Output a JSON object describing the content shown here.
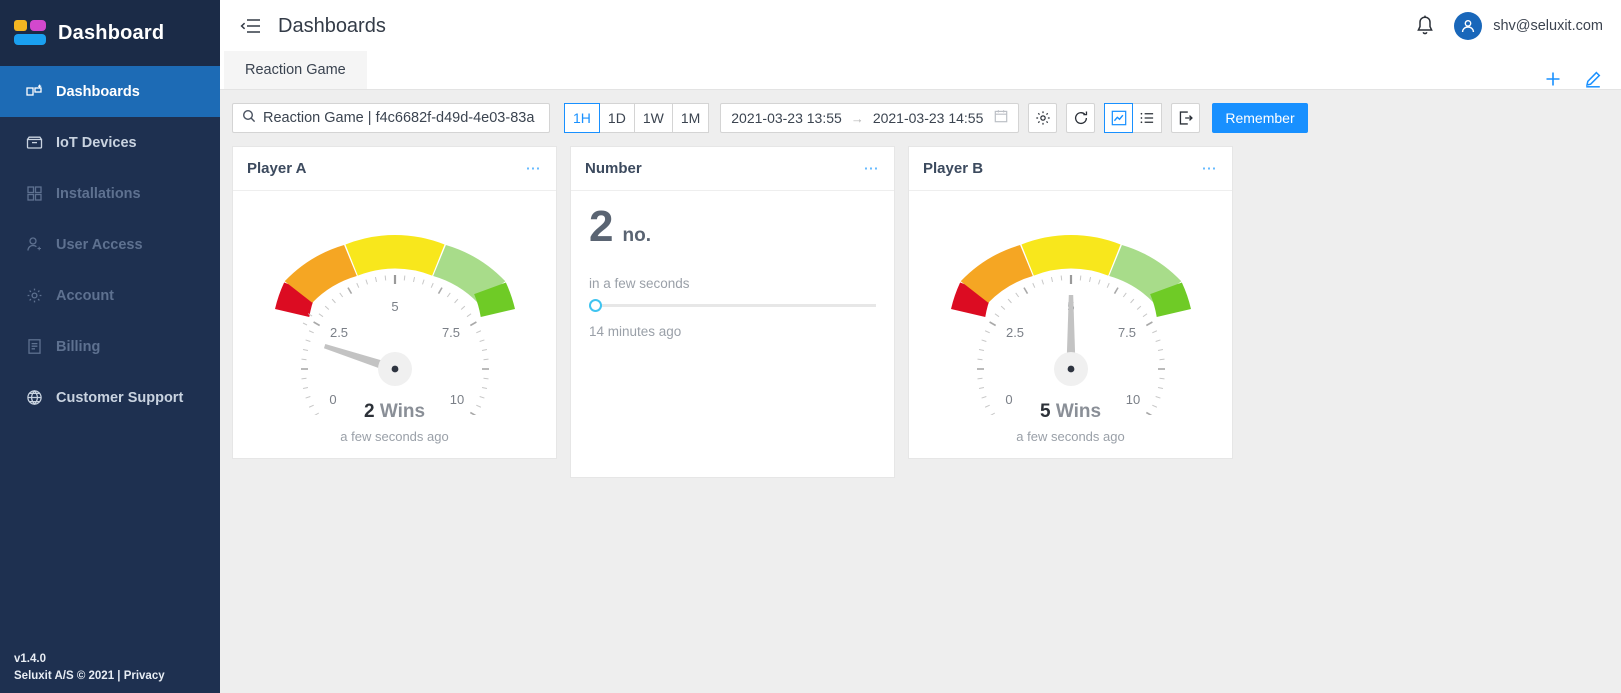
{
  "brand": {
    "name": "Dashboard",
    "logo_icon": "dashboard-logo-icon"
  },
  "sidebar": {
    "items": [
      {
        "label": "Dashboards",
        "icon": "dashboards-icon",
        "state": "active"
      },
      {
        "label": "IoT Devices",
        "icon": "inbox-icon",
        "state": "enabled"
      },
      {
        "label": "Installations",
        "icon": "grid-icon",
        "state": "disabled"
      },
      {
        "label": "User Access",
        "icon": "user-add-icon",
        "state": "disabled"
      },
      {
        "label": "Account",
        "icon": "gear-icon",
        "state": "disabled"
      },
      {
        "label": "Billing",
        "icon": "receipt-icon",
        "state": "disabled"
      },
      {
        "label": "Customer Support",
        "icon": "globe-icon",
        "state": "enabled"
      }
    ],
    "footer": {
      "version": "v1.4.0",
      "copyright": "Seluxit A/S © 2021 | Privacy"
    }
  },
  "topbar": {
    "menu_icon": "collapse-menu-icon",
    "title": "Dashboards",
    "bell_icon": "bell-icon",
    "avatar_icon": "user-avatar-icon",
    "user_email": "shv@seluxit.com"
  },
  "tabs": {
    "items": [
      {
        "label": "Reaction Game",
        "active": true
      }
    ],
    "actions": [
      {
        "icon": "plus-icon",
        "name": "add-dashboard-button"
      },
      {
        "icon": "pencil-icon",
        "name": "edit-dashboard-button"
      }
    ]
  },
  "toolbar": {
    "search": {
      "icon": "search-icon",
      "value": "Reaction Game | f4c6682f-d49d-4e03-83a",
      "placeholder": "Search"
    },
    "ranges": [
      {
        "label": "1H",
        "selected": true
      },
      {
        "label": "1D",
        "selected": false
      },
      {
        "label": "1W",
        "selected": false
      },
      {
        "label": "1M",
        "selected": false
      }
    ],
    "date_from": "2021-03-23 13:55",
    "date_arrow": "→",
    "date_to": "2021-03-23 14:55",
    "calendar_icon": "calendar-icon",
    "settings_icon": "gear-icon",
    "refresh_icon": "refresh-icon",
    "view_chart_icon": "line-chart-icon",
    "view_list_icon": "list-icon",
    "export_icon": "export-icon",
    "primary_button": "Remember",
    "accent_color": "#1890ff"
  },
  "cards": [
    {
      "title": "Player A",
      "type": "gauge",
      "menu_icon": "more-options-icon",
      "value": 2,
      "value_text": "2",
      "unit": "Wins",
      "timestamp": "a few seconds ago"
    },
    {
      "title": "Number",
      "type": "number",
      "menu_icon": "more-options-icon",
      "value_text": "2",
      "unit": "no.",
      "progress_label": "in a few seconds",
      "progress_percent": 0,
      "timestamp": "14 minutes ago"
    },
    {
      "title": "Player B",
      "type": "gauge",
      "menu_icon": "more-options-icon",
      "value": 5,
      "value_text": "5",
      "unit": "Wins",
      "timestamp": "a few seconds ago"
    }
  ],
  "gauge": {
    "min": 0,
    "max": 10,
    "ticks": [
      "0",
      "2.5",
      "5",
      "7.5",
      "10"
    ],
    "band_colors": [
      "#dc0c22",
      "#f5a623",
      "#f8e71c",
      "#a8dc8a",
      "#6fcb26"
    ]
  }
}
